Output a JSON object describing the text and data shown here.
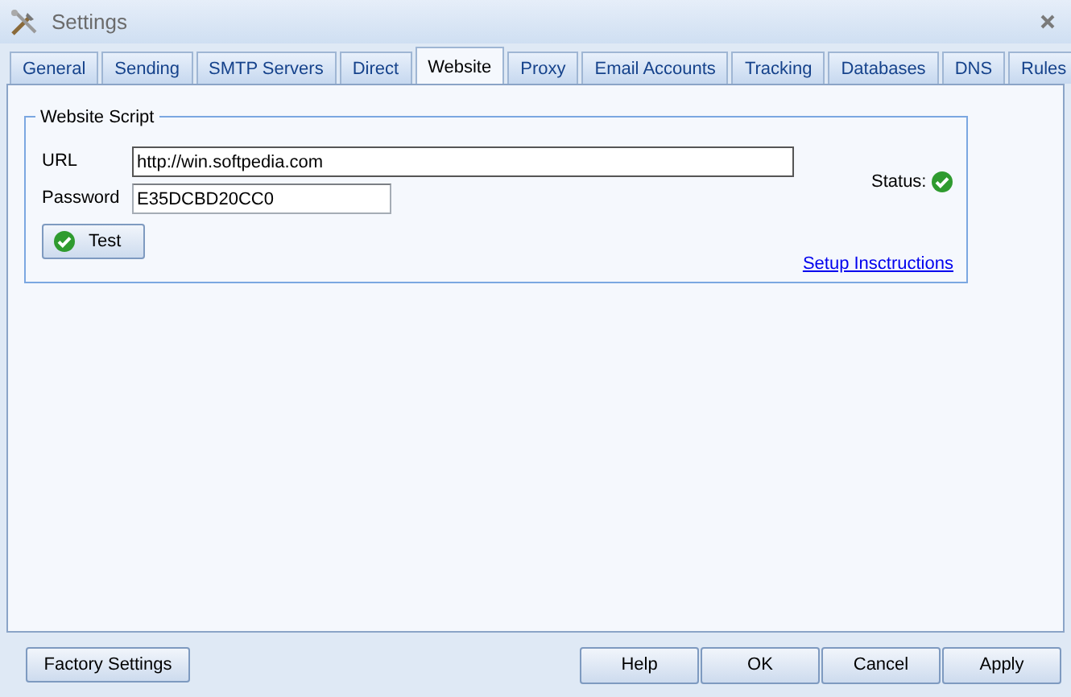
{
  "window": {
    "title": "Settings"
  },
  "tabs": [
    {
      "label": "General",
      "selected": false
    },
    {
      "label": "Sending",
      "selected": false
    },
    {
      "label": "SMTP Servers",
      "selected": false
    },
    {
      "label": "Direct",
      "selected": false
    },
    {
      "label": "Website",
      "selected": true
    },
    {
      "label": "Proxy",
      "selected": false
    },
    {
      "label": "Email Accounts",
      "selected": false
    },
    {
      "label": "Tracking",
      "selected": false
    },
    {
      "label": "Databases",
      "selected": false
    },
    {
      "label": "DNS",
      "selected": false
    },
    {
      "label": "Rules",
      "selected": false
    }
  ],
  "group": {
    "title": "Website Script",
    "fields": [
      {
        "label": "URL",
        "value": "http://win.softpedia.com",
        "focused": true
      },
      {
        "label": "Password",
        "value": "E35DCBD20CC0",
        "focused": false
      }
    ],
    "status_label": "Status:",
    "status_ok": true,
    "test_button": "Test",
    "link": "Setup Insctructions"
  },
  "footer": {
    "left_button": "Factory Settings",
    "buttons": [
      "Help",
      "OK",
      "Cancel",
      "Apply"
    ]
  }
}
